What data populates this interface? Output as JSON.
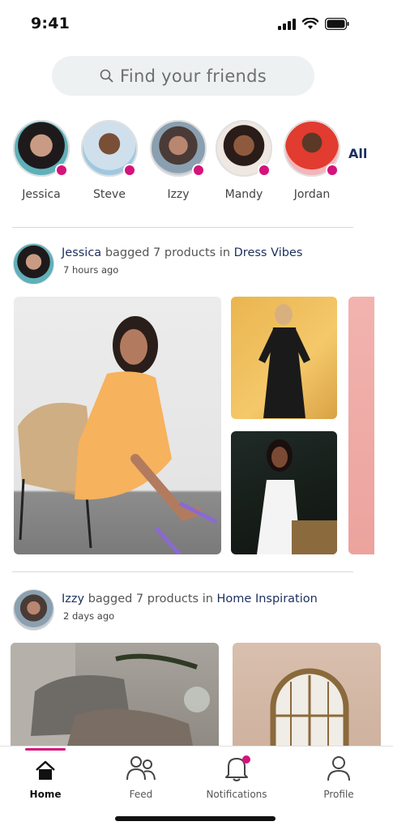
{
  "status": {
    "time": "9:41"
  },
  "search": {
    "placeholder": "Find your friends"
  },
  "stories": {
    "friends": [
      {
        "name": "Jessica"
      },
      {
        "name": "Steve"
      },
      {
        "name": "Izzy"
      },
      {
        "name": "Mandy"
      },
      {
        "name": "Jordan"
      }
    ],
    "all_label": "All"
  },
  "posts": [
    {
      "user": "Jessica",
      "action": "bagged 7 products in",
      "board": "Dress Vibes",
      "time": "7 hours ago"
    },
    {
      "user": "Izzy",
      "action": "bagged 7 products in",
      "board": "Home Inspiration",
      "time": "2 days ago"
    }
  ],
  "tabs": [
    {
      "label": "Home",
      "icon": "home-icon",
      "active": true
    },
    {
      "label": "Feed",
      "icon": "people-icon",
      "active": false
    },
    {
      "label": "Notifications",
      "icon": "bell-icon",
      "active": false
    },
    {
      "label": "Profile",
      "icon": "person-icon",
      "active": false
    }
  ],
  "colors": {
    "accent": "#d4137b",
    "navy": "#1c2f5e",
    "search_bg": "#eef1f2"
  }
}
